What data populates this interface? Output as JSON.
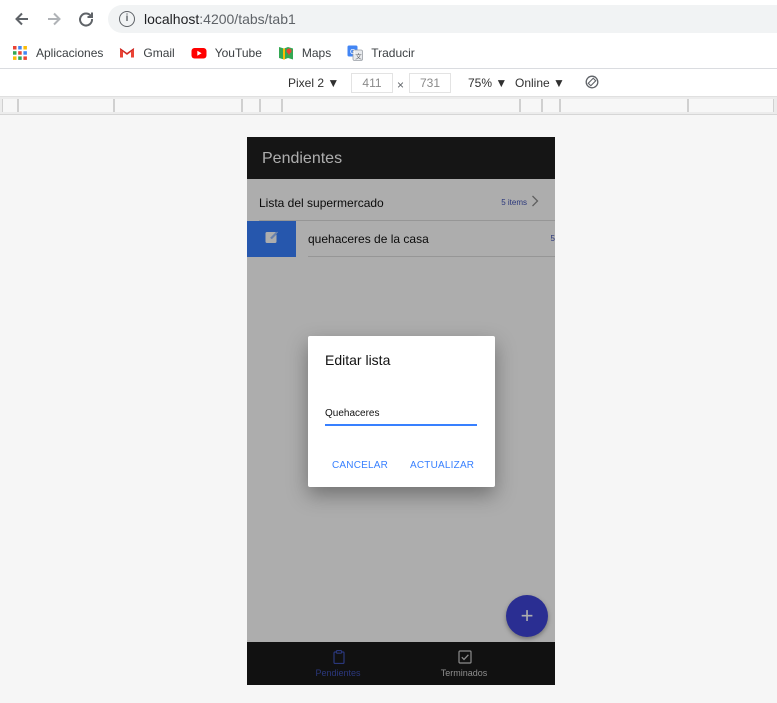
{
  "browser": {
    "url_host": "localhost",
    "url_path": ":4200/tabs/tab1",
    "bookmarks": [
      {
        "label": "Aplicaciones",
        "icon": "apps-grid-icon"
      },
      {
        "label": "Gmail",
        "icon": "gmail-icon"
      },
      {
        "label": "YouTube",
        "icon": "youtube-icon"
      },
      {
        "label": "Maps",
        "icon": "maps-icon"
      },
      {
        "label": "Traducir",
        "icon": "translate-icon"
      }
    ]
  },
  "devtools": {
    "device": "Pixel 2",
    "width": "411",
    "times": "×",
    "height": "731",
    "zoom": "75%",
    "network": "Online"
  },
  "app": {
    "title": "Pendientes",
    "lists": [
      {
        "name": "Lista del supermercado",
        "count": "5 items"
      },
      {
        "name": "quehaceres de la casa",
        "count": "5"
      }
    ],
    "fab_symbol": "+",
    "tabs": [
      {
        "label": "Pendientes",
        "icon": "clipboard-icon",
        "active": true
      },
      {
        "label": "Terminados",
        "icon": "checkbox-icon",
        "active": false
      }
    ]
  },
  "alert": {
    "title": "Editar lista",
    "input_value": "Quehaceres",
    "cancel": "CANCELAR",
    "update": "ACTUALIZAR"
  },
  "colors": {
    "primary": "#3880ff",
    "fab": "#3f44d7",
    "toolbar": "#1f1f1f",
    "active_tab": "#3f51b5"
  }
}
